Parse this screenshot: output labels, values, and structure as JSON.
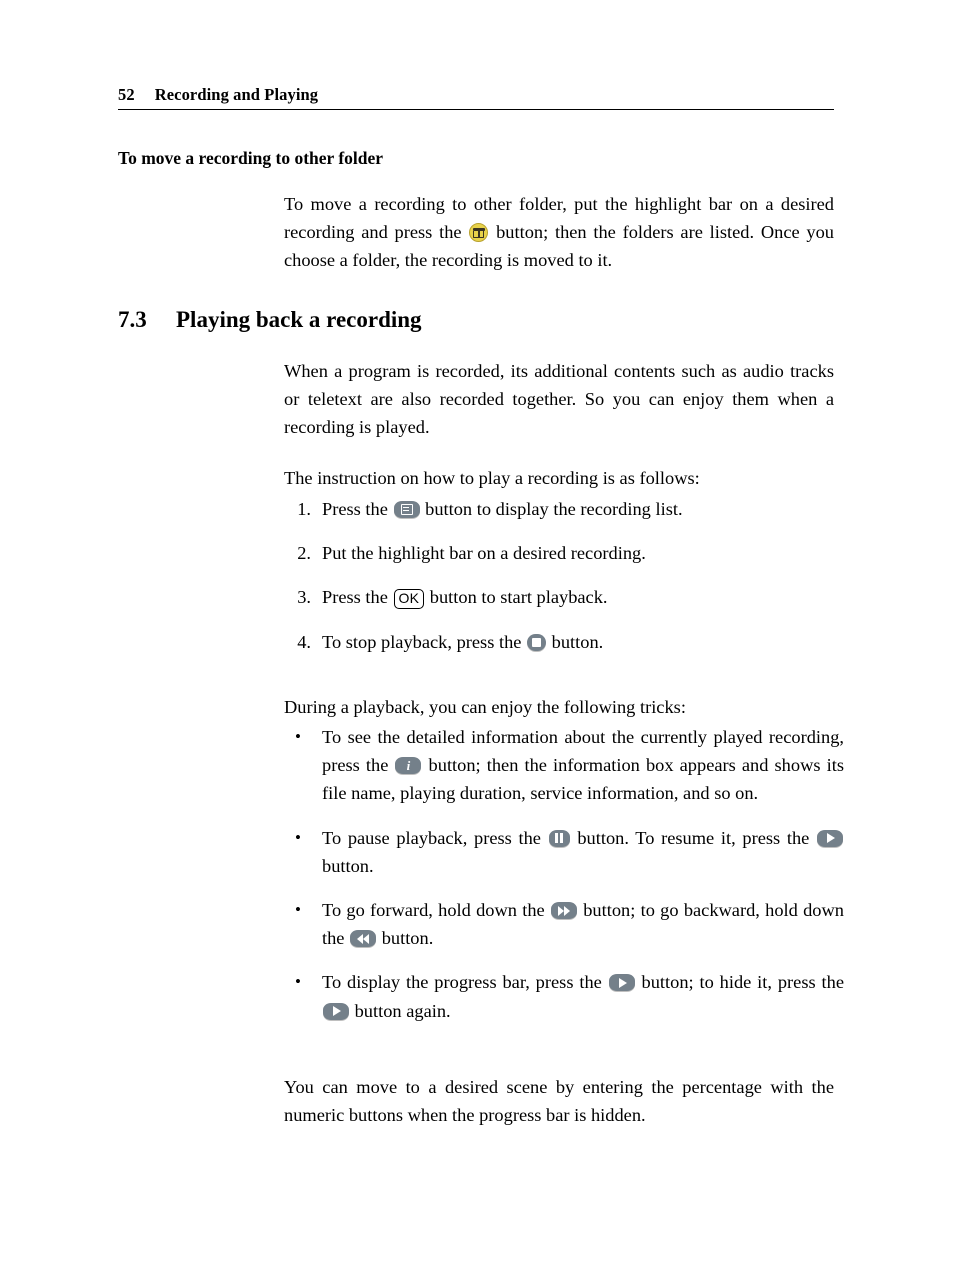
{
  "header": {
    "page_number": "52",
    "title": "Recording and Playing"
  },
  "subheading": "To move a recording to other folder",
  "intro_paragraph": {
    "part1": "To move a recording to other folder, put the highlight bar on a desired recording and press the",
    "part2": "button; then the folders are listed. Once you choose a folder, the recording is moved to it.",
    "icon": "archive-button-icon"
  },
  "section": {
    "number": "7.3",
    "title": "Playing back a recording"
  },
  "section_body": {
    "paragraph1": "When a program is recorded, its additional contents such as audio tracks or teletext are also recorded together. So you can enjoy them when a recording is played.",
    "paragraph2": "The instruction on how to play a recording is as follows:"
  },
  "steps": [
    {
      "marker": "1.",
      "before": "Press the",
      "icon": "list-button-icon",
      "after": "button to display the recording list."
    },
    {
      "marker": "2.",
      "before": "Put the highlight bar on a desired recording.",
      "icon": "",
      "after": ""
    },
    {
      "marker": "3.",
      "before": "Press the",
      "icon": "ok-button-key",
      "icon_label": "OK",
      "after": "button to start playback."
    },
    {
      "marker": "4.",
      "before": "To stop playback, press the",
      "icon": "stop-button-icon",
      "after": "button."
    }
  ],
  "tricks_intro": "During a playback, you can enjoy the following tricks:",
  "tricks": [
    {
      "marker": "•",
      "part1": "To see the detailed information about the currently played recording, press the",
      "icon1": "info-button-icon",
      "part2": "button; then the information box appears and shows its file name, playing duration, service information, and so on.",
      "icon2": "",
      "part3": ""
    },
    {
      "marker": "•",
      "part1": "To pause playback, press the",
      "icon1": "pause-button-icon",
      "part2": "button.  To resume it, press the",
      "icon2": "play-button-icon",
      "part3": "button."
    },
    {
      "marker": "•",
      "part1": "To go forward, hold down the",
      "icon1": "fast-forward-button-icon",
      "part2": "button; to go backward, hold down the",
      "icon2": "rewind-button-icon",
      "part3": "button."
    },
    {
      "marker": "•",
      "part1": "To display the progress bar, press the",
      "icon1": "play-button-icon",
      "part2": "button; to hide it, press the",
      "icon2": "play-button-icon",
      "part3": "button again."
    }
  ],
  "closing_paragraph": "You can move to a desired scene by entering the percentage with the numeric buttons when the progress bar is hidden.",
  "colors": {
    "button_grey": "#74808a",
    "button_yellow": "#e8d24a",
    "text": "#000000",
    "page_background": "#ffffff"
  }
}
